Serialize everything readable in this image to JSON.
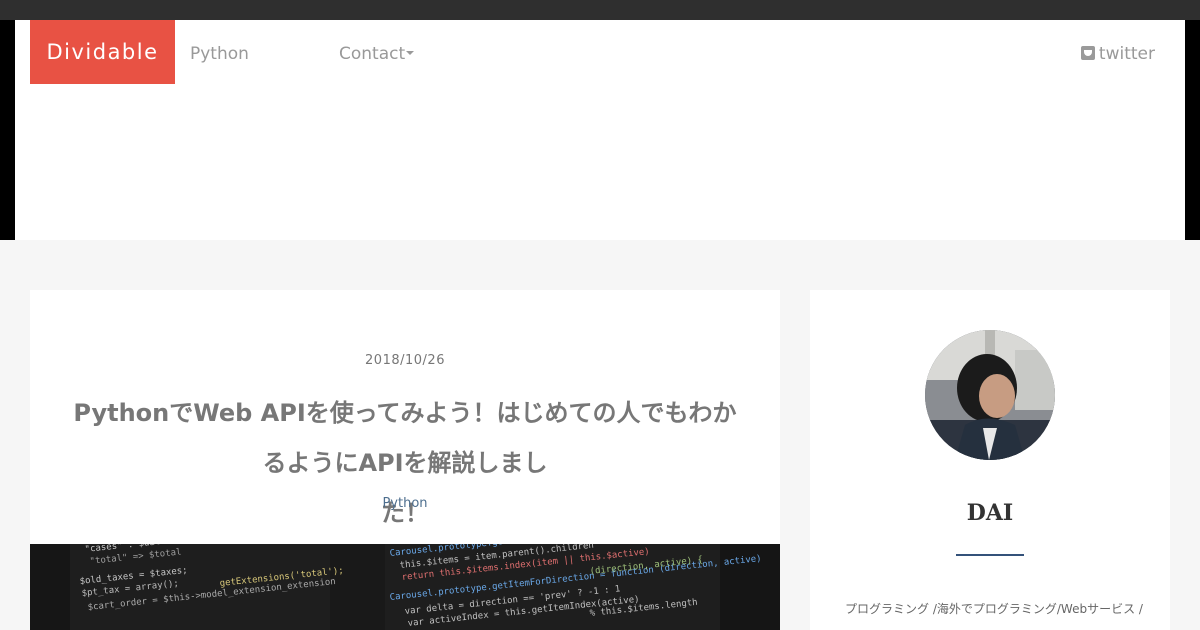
{
  "brand": {
    "name": "Dividable",
    "color": "#e85244"
  },
  "nav": {
    "python": "Python",
    "contact": "Contact",
    "twitter": "twitter"
  },
  "post": {
    "date": "2018/10/26",
    "title": "PythonでWeb APIを使ってみよう！はじめての人でもわかるようにAPIを解説しまし",
    "title_line2": "た！",
    "category": "Python"
  },
  "sidebar": {
    "author_name": "DAI",
    "author_bio": "プログラミング /海外でプログラミング/Webサービス / 海外ノマド起業家/"
  },
  "icons": {
    "twitter": "twitter-icon",
    "caret": "caret-down-icon"
  }
}
